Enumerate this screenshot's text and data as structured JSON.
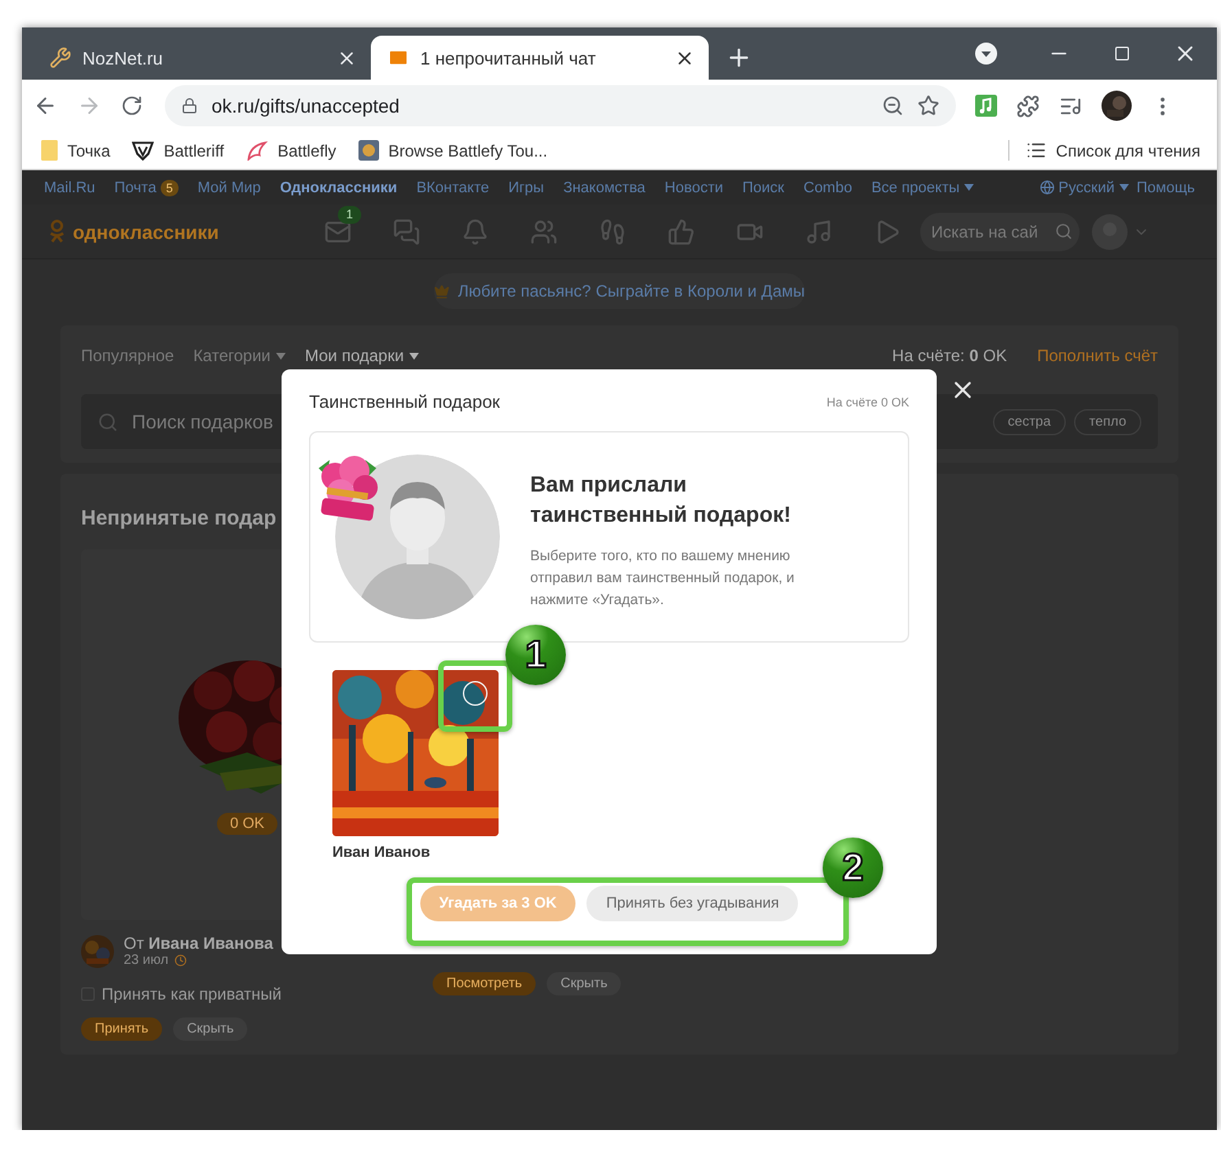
{
  "browser": {
    "tabs": [
      {
        "title": "NozNet.ru",
        "selected": false
      },
      {
        "title": "1 непрочитанный чат",
        "selected": true
      }
    ],
    "address": "ok.ru/gifts/unaccepted",
    "bookmarks": [
      "Точка",
      "Battleriff",
      "Battlefly",
      "Browse Battlefy Tou..."
    ],
    "reading_list": "Список для чтения"
  },
  "portal_bar": {
    "links": [
      {
        "label": "Mail.Ru",
        "selected": false
      },
      {
        "label": "Почта",
        "selected": false,
        "badge": "5"
      },
      {
        "label": "Мой Мир",
        "selected": false
      },
      {
        "label": "Одноклассники",
        "selected": true
      },
      {
        "label": "ВКонтакте",
        "selected": false
      },
      {
        "label": "Игры",
        "selected": false
      },
      {
        "label": "Знакомства",
        "selected": false
      },
      {
        "label": "Новости",
        "selected": false
      },
      {
        "label": "Поиск",
        "selected": false
      },
      {
        "label": "Combo",
        "selected": false
      },
      {
        "label": "Все проекты",
        "selected": false,
        "dropdown": true
      }
    ],
    "language": "Русский",
    "help": "Помощь"
  },
  "header": {
    "logo": "одноклассники",
    "message_badge": "1",
    "search_placeholder": "Искать на сай"
  },
  "banner": "Любите пасьянс? Сыграйте в Короли и Дамы",
  "gifts_nav": {
    "tabs": [
      {
        "label": "Популярное",
        "selected": false,
        "dropdown": false
      },
      {
        "label": "Категории",
        "selected": false,
        "dropdown": true
      },
      {
        "label": "Мои подарки",
        "selected": true,
        "dropdown": true
      }
    ],
    "balance": "На счёте: **0** OK",
    "top_up": "Пополнить счёт"
  },
  "gift_search": {
    "placeholder": "Поиск подарков",
    "tags": [
      "сестра",
      "тепло"
    ]
  },
  "unaccepted": {
    "title": "Непринятые подар",
    "gifts": [
      {
        "price": "0 OK",
        "sender": "От **Ивана Иванова**",
        "date": "23 июл",
        "private_label": "Принять как приватный",
        "private_checked": false,
        "buttons": [
          {
            "label": "Принять",
            "kind": "primary"
          },
          {
            "label": "Скрыть",
            "kind": "secondary"
          }
        ]
      },
      {
        "buttons": [
          {
            "label": "Посмотреть",
            "kind": "primary"
          },
          {
            "label": "Скрыть",
            "kind": "secondary"
          }
        ]
      }
    ]
  },
  "modal": {
    "title": "Таинственный подарок",
    "balance": "На счёте 0 OK",
    "heading": "Вам прислали таинственный подарок!",
    "text": "Выберите того, кто по вашему мнению отправил вам таинственный подарок, и нажмите «Угадать».",
    "candidates": [
      {
        "name": "Иван Иванов",
        "selected": false
      }
    ],
    "buttons": [
      {
        "label": "Угадать за 3 OK",
        "kind": "primary",
        "disabled": true
      },
      {
        "label": "Принять без угадывания",
        "kind": "secondary",
        "disabled": false
      }
    ]
  },
  "annotations": [
    {
      "label": "1"
    },
    {
      "label": "2"
    }
  ]
}
